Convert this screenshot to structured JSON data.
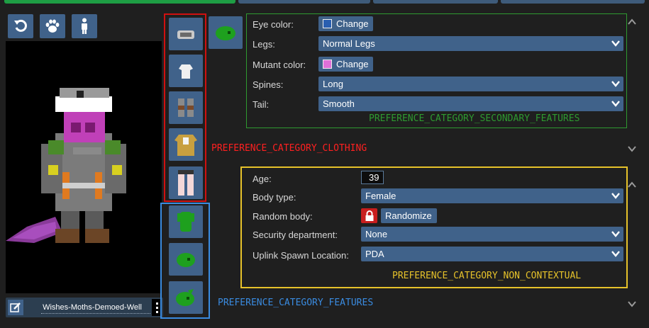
{
  "colors": {
    "accent": "#40628a",
    "eye_swatch": "#2a5fb0",
    "mutant_swatch": "#e070d8",
    "red_annot": "#ff2020",
    "green_annot": "#2e9a30",
    "blue_annot": "#3a8be0",
    "yellow_annot": "#e6c22a",
    "lock": "#c81e1e"
  },
  "toolbar": {
    "icons": [
      "rotate-icon",
      "paw-icon",
      "person-icon"
    ]
  },
  "character": {
    "name": "Wishes-Moths-Demoed-Well"
  },
  "secondary_features": {
    "eye_color": {
      "label": "Eye color:",
      "button": "Change"
    },
    "legs": {
      "label": "Legs:",
      "value": "Normal Legs"
    },
    "mutant_color": {
      "label": "Mutant color:",
      "button": "Change"
    },
    "spines": {
      "label": "Spines:",
      "value": "Long"
    },
    "tail": {
      "label": "Tail:",
      "value": "Smooth"
    },
    "category_label": "PREFERENCE_CATEGORY_SECONDARY_FEATURES"
  },
  "clothing_category_label": "PREFERENCE_CATEGORY_CLOTHING",
  "features_category_label": "PREFERENCE_CATEGORY_FEATURES",
  "non_contextual": {
    "age": {
      "label": "Age:",
      "value": "39"
    },
    "body_type": {
      "label": "Body type:",
      "value": "Female"
    },
    "random_body": {
      "label": "Random body:",
      "button": "Randomize"
    },
    "security_department": {
      "label": "Security department:",
      "value": "None"
    },
    "uplink_spawn": {
      "label": "Uplink Spawn Location:",
      "value": "PDA"
    },
    "category_label": "PREFERENCE_CATEGORY_NON_CONTEXTUAL"
  }
}
